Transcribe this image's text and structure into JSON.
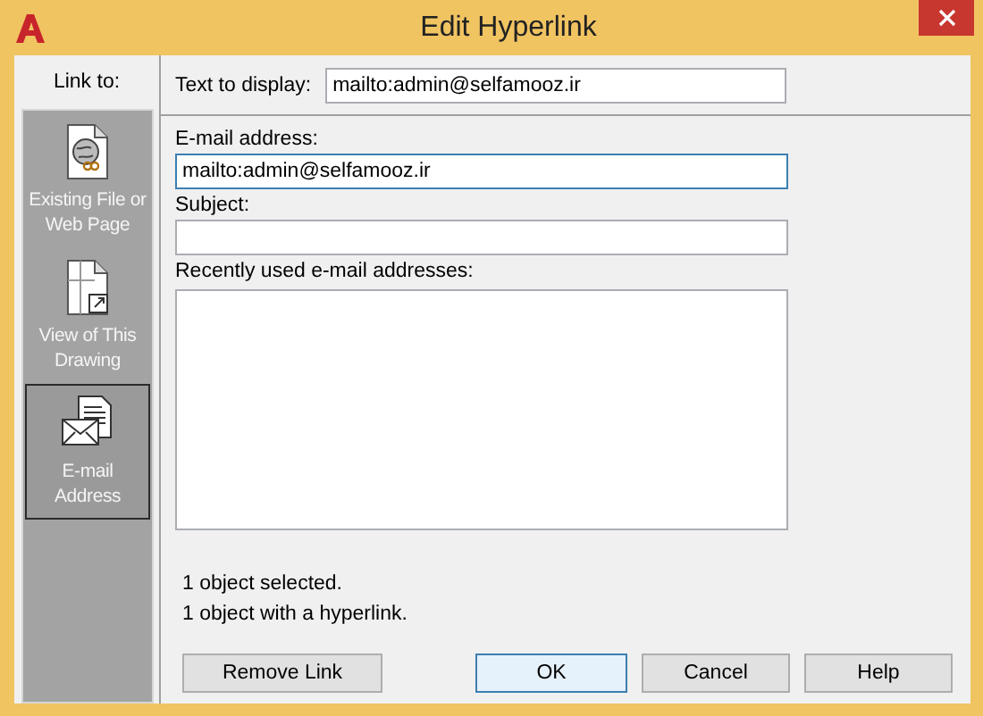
{
  "window": {
    "title": "Edit Hyperlink"
  },
  "link_to": {
    "label": "Link to:",
    "items": [
      {
        "kind": "file",
        "label": "Existing File or Web Page",
        "selected": false
      },
      {
        "kind": "drawing",
        "label": "View of This Drawing",
        "selected": false
      },
      {
        "kind": "email",
        "label": "E-mail Address",
        "selected": true
      }
    ]
  },
  "text_to_display": {
    "label": "Text to display:",
    "value": "mailto:admin@selfamooz.ir"
  },
  "email_address": {
    "label": "E-mail address:",
    "value": "mailto:admin@selfamooz.ir",
    "focused": true
  },
  "subject": {
    "label": "Subject:",
    "focused": false
  },
  "recent_addresses": {
    "label": "Recently used e-mail addresses:"
  },
  "status": [
    "1 object selected.",
    "1 object with a hyperlink."
  ],
  "buttons": [
    {
      "label": "Remove Link",
      "default": false
    },
    {
      "label": "OK",
      "default": true
    },
    {
      "label": "Cancel",
      "default": false
    },
    {
      "label": "Help",
      "default": false
    }
  ]
}
